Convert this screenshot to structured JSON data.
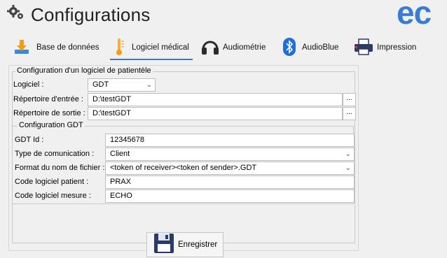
{
  "header": {
    "title": "Configurations",
    "brand": "ec",
    "brand_color": "#3a7bd5"
  },
  "tabs": [
    {
      "label": "Base de données",
      "icon": "download-icon",
      "active": false
    },
    {
      "label": "Logiciel médical",
      "icon": "thermometer-icon",
      "active": true
    },
    {
      "label": "Audiométrie",
      "icon": "headphones-icon",
      "active": false
    },
    {
      "label": "AudioBlue",
      "icon": "bluetooth-icon",
      "active": false
    },
    {
      "label": "Impression",
      "icon": "printer-icon",
      "active": false
    }
  ],
  "accent_color": "#3a78c8",
  "config_group": {
    "legend": "Configuration d'un logiciel de patientèle",
    "logiciel_label": "Logiciel :",
    "logiciel_value": "GDT",
    "input_dir_label": "Répertoire d'entrée :",
    "input_dir_value": "D:\\testGDT",
    "output_dir_label": "Répertoire de sortie :",
    "output_dir_value": "D:\\testGDT",
    "browse_label": "..."
  },
  "gdt_group": {
    "legend": "Configuration GDT",
    "gdt_id_label": "GDT Id :",
    "gdt_id_value": "12345678",
    "comm_type_label": "Type de comunication :",
    "comm_type_value": "Client",
    "file_format_label": "Format du nom de fichier :",
    "file_format_value": "<token of receiver><token of sender>.GDT",
    "patient_code_label": "Code logiciel patient :",
    "patient_code_value": "PRAX",
    "measure_code_label": "Code logiciel mesure :",
    "measure_code_value": "ECHO"
  },
  "save_button": {
    "label": "Enregistrer",
    "icon": "floppy-disk-icon"
  }
}
